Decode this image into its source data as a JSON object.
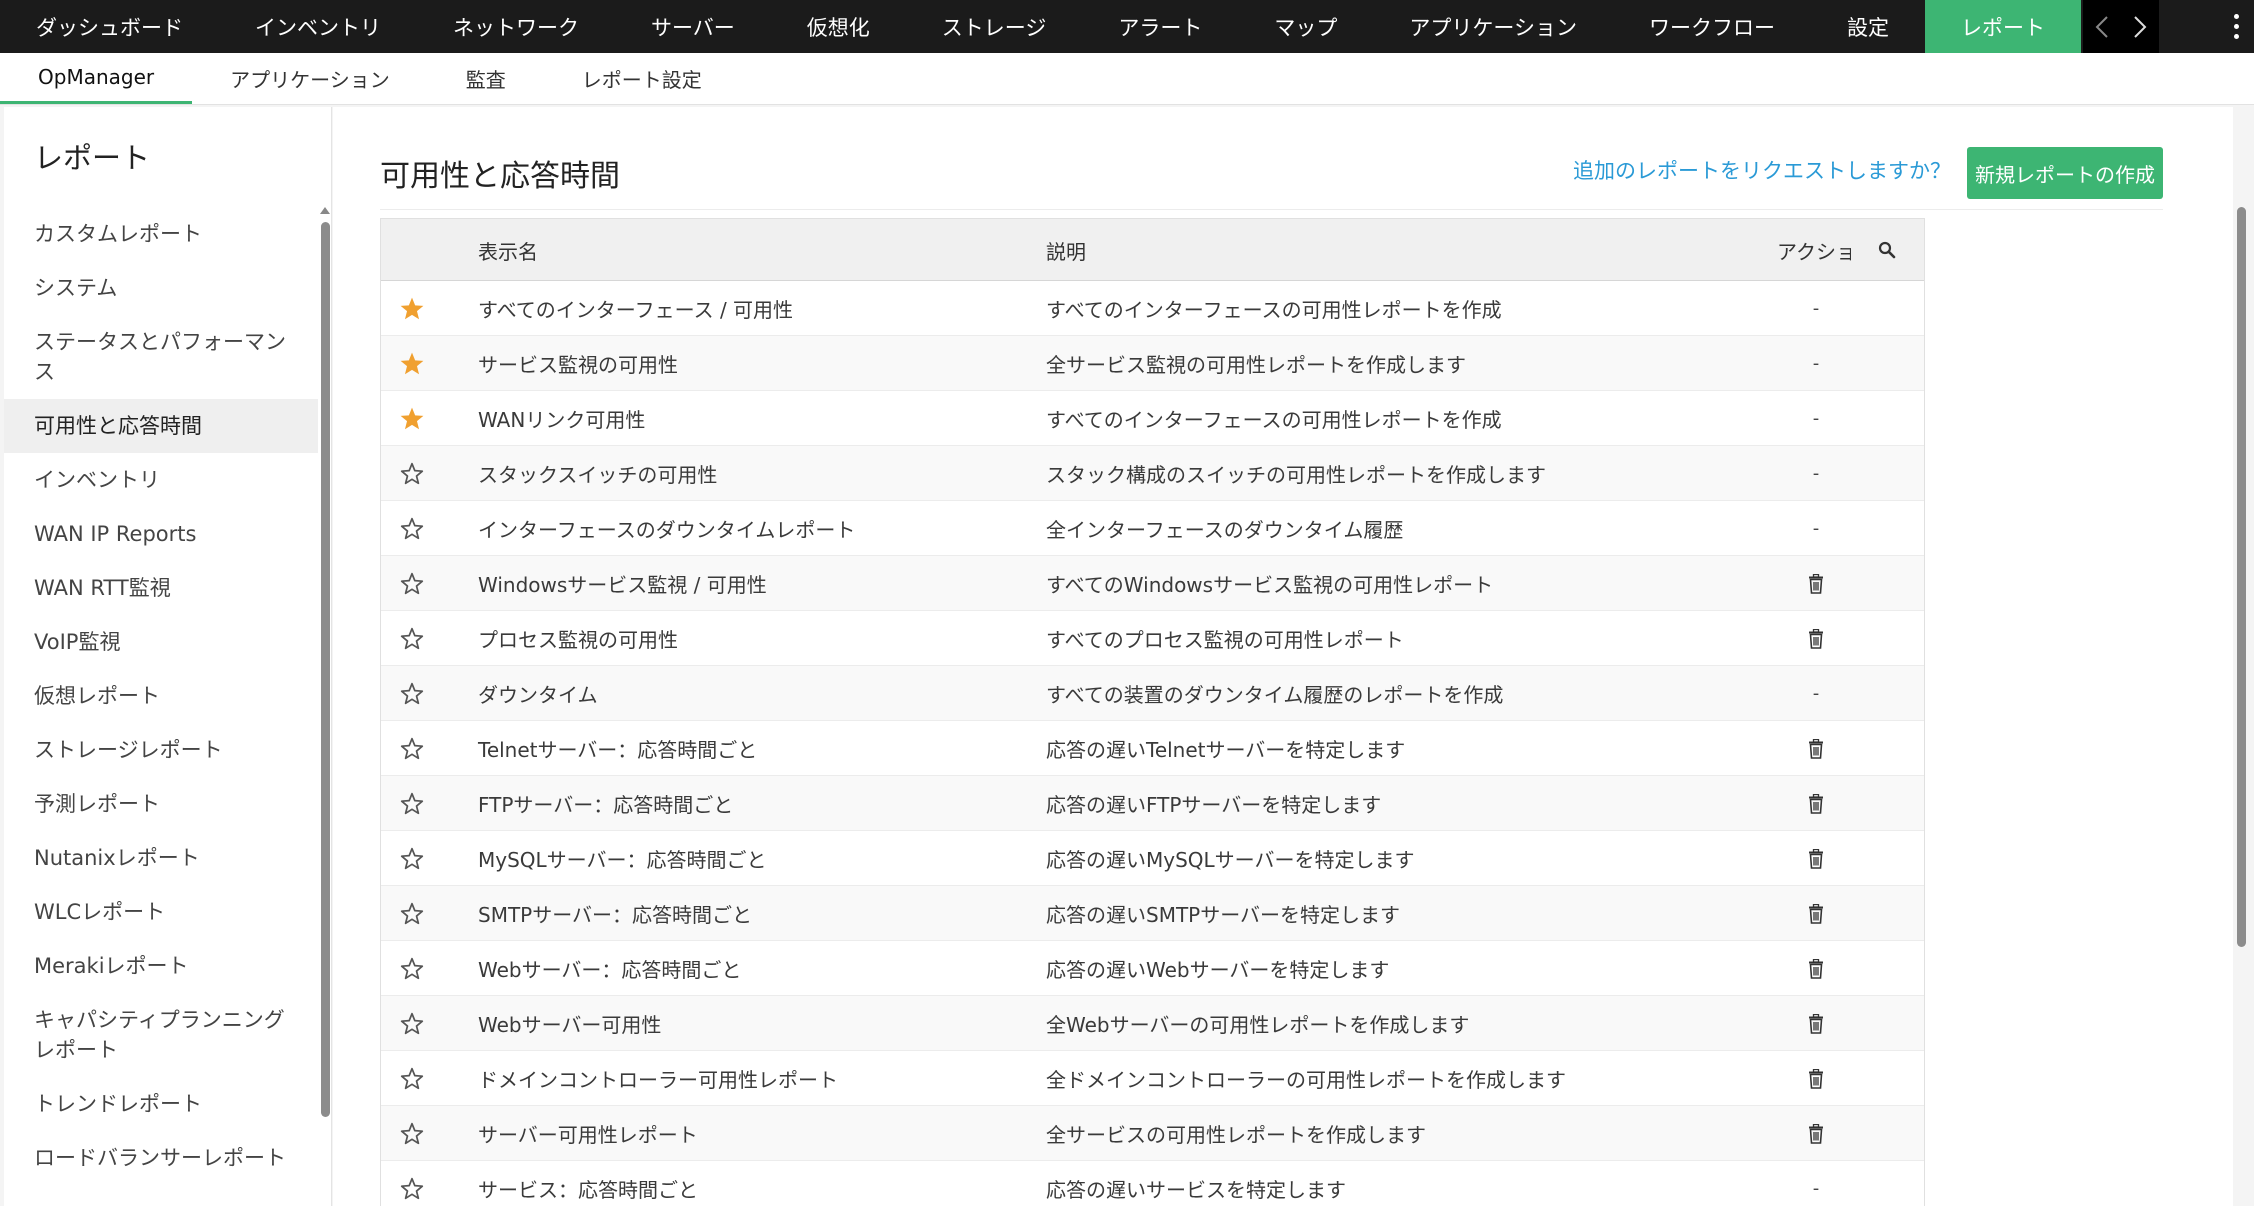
{
  "topnav": {
    "items": [
      {
        "label": "ダッシュボード",
        "active": false
      },
      {
        "label": "インベントリ",
        "active": false
      },
      {
        "label": "ネットワーク",
        "active": false
      },
      {
        "label": "サーバー",
        "active": false
      },
      {
        "label": "仮想化",
        "active": false
      },
      {
        "label": "ストレージ",
        "active": false
      },
      {
        "label": "アラート",
        "active": false
      },
      {
        "label": "マップ",
        "active": false
      },
      {
        "label": "アプリケーション",
        "active": false
      },
      {
        "label": "ワークフロー",
        "active": false
      },
      {
        "label": "設定",
        "active": false
      },
      {
        "label": "レポート",
        "active": true
      }
    ],
    "icons": {
      "prev": "chevron-left-icon",
      "next": "chevron-right-icon",
      "more": "kebab-menu-icon"
    }
  },
  "subnav": {
    "items": [
      {
        "label": "OpManager",
        "active": true
      },
      {
        "label": "アプリケーション",
        "active": false
      },
      {
        "label": "監査",
        "active": false
      },
      {
        "label": "レポート設定",
        "active": false
      }
    ]
  },
  "sidebar": {
    "title": "レポート",
    "items": [
      {
        "label": "カスタムレポート",
        "active": false
      },
      {
        "label": "システム",
        "active": false
      },
      {
        "label": "ステータスとパフォーマンス",
        "active": false
      },
      {
        "label": "可用性と応答時間",
        "active": true
      },
      {
        "label": "インベントリ",
        "active": false
      },
      {
        "label": "WAN IP Reports",
        "active": false
      },
      {
        "label": "WAN RTT監視",
        "active": false
      },
      {
        "label": "VoIP監視",
        "active": false
      },
      {
        "label": "仮想レポート",
        "active": false
      },
      {
        "label": "ストレージレポート",
        "active": false
      },
      {
        "label": "予測レポート",
        "active": false
      },
      {
        "label": "Nutanixレポート",
        "active": false
      },
      {
        "label": "WLCレポート",
        "active": false
      },
      {
        "label": "Merakiレポート",
        "active": false
      },
      {
        "label": "キャパシティプランニングレポート",
        "active": false
      },
      {
        "label": "トレンドレポート",
        "active": false
      },
      {
        "label": "ロードバランサーレポート",
        "active": false
      }
    ]
  },
  "main": {
    "title": "可用性と応答時間",
    "request_link": "追加のレポートをリクエストしますか？",
    "create_button": "新規レポートの作成",
    "table": {
      "columns": {
        "name": "表示名",
        "description": "説明",
        "action": "アクション"
      },
      "icons": {
        "star_filled": "star-filled-icon",
        "star_empty": "star-outline-icon",
        "delete": "trash-icon",
        "search": "search-icon"
      },
      "colors": {
        "star": "#f0a030",
        "accent": "#3db573",
        "link": "#2a9ad6"
      },
      "rows": [
        {
          "favorite": true,
          "name": "すべてのインターフェース / 可用性",
          "description": "すべてのインターフェースの可用性レポートを作成",
          "action": "-"
        },
        {
          "favorite": true,
          "name": "サービス監視の可用性",
          "description": "全サービス監視の可用性レポートを作成します",
          "action": "-"
        },
        {
          "favorite": true,
          "name": "WANリンク可用性",
          "description": "すべてのインターフェースの可用性レポートを作成",
          "action": "-"
        },
        {
          "favorite": false,
          "name": "スタックスイッチの可用性",
          "description": "スタック構成のスイッチの可用性レポートを作成します",
          "action": "-"
        },
        {
          "favorite": false,
          "name": "インターフェースのダウンタイムレポート",
          "description": "全インターフェースのダウンタイム履歴",
          "action": "-"
        },
        {
          "favorite": false,
          "name": "Windowsサービス監視 / 可用性",
          "description": "すべてのWindowsサービス監視の可用性レポート",
          "action": "delete"
        },
        {
          "favorite": false,
          "name": "プロセス監視の可用性",
          "description": "すべてのプロセス監視の可用性レポート",
          "action": "delete"
        },
        {
          "favorite": false,
          "name": "ダウンタイム",
          "description": "すべての装置のダウンタイム履歴のレポートを作成",
          "action": "-"
        },
        {
          "favorite": false,
          "name": "Telnetサーバー：応答時間ごと",
          "description": "応答の遅いTelnetサーバーを特定します",
          "action": "delete"
        },
        {
          "favorite": false,
          "name": "FTPサーバー：応答時間ごと",
          "description": "応答の遅いFTPサーバーを特定します",
          "action": "delete"
        },
        {
          "favorite": false,
          "name": "MySQLサーバー：応答時間ごと",
          "description": "応答の遅いMySQLサーバーを特定します",
          "action": "delete"
        },
        {
          "favorite": false,
          "name": "SMTPサーバー：応答時間ごと",
          "description": "応答の遅いSMTPサーバーを特定します",
          "action": "delete"
        },
        {
          "favorite": false,
          "name": "Webサーバー：応答時間ごと",
          "description": "応答の遅いWebサーバーを特定します",
          "action": "delete"
        },
        {
          "favorite": false,
          "name": "Webサーバー可用性",
          "description": "全Webサーバーの可用性レポートを作成します",
          "action": "delete"
        },
        {
          "favorite": false,
          "name": "ドメインコントローラー可用性レポート",
          "description": "全ドメインコントローラーの可用性レポートを作成します",
          "action": "delete"
        },
        {
          "favorite": false,
          "name": "サーバー可用性レポート",
          "description": "全サービスの可用性レポートを作成します",
          "action": "delete"
        },
        {
          "favorite": false,
          "name": "サービス：応答時間ごと",
          "description": "応答の遅いサービスを特定します",
          "action": "-"
        }
      ]
    }
  }
}
